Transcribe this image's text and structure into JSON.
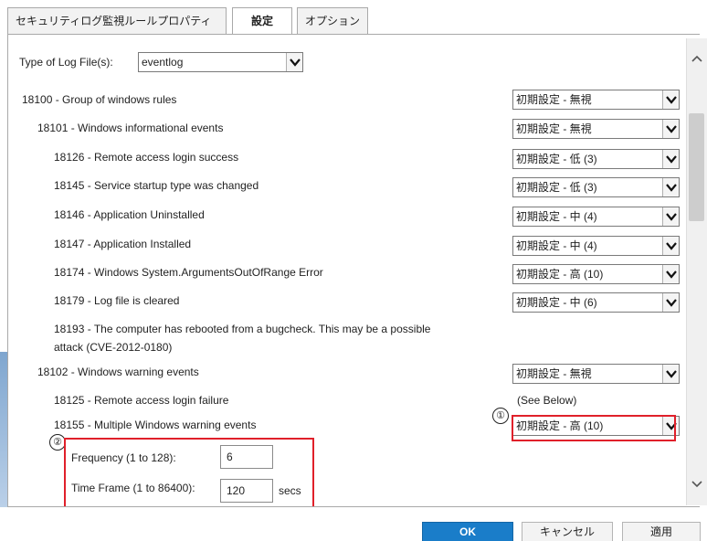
{
  "tabs": [
    {
      "label": "セキュリティログ監視ルールプロパティ"
    },
    {
      "label": "設定"
    },
    {
      "label": "オプション"
    }
  ],
  "log_type": {
    "label": "Type of Log File(s):",
    "value": "eventlog"
  },
  "rules": [
    {
      "text": "18100 - Group of windows rules",
      "level": "初期設定 - 無視"
    },
    {
      "text": "18101 - Windows informational events",
      "level": "初期設定 - 無視"
    },
    {
      "text": "18126 - Remote access login success",
      "level": "初期設定 - 低 (3)"
    },
    {
      "text": "18145 - Service startup type was changed",
      "level": "初期設定 - 低 (3)"
    },
    {
      "text": "18146 - Application Uninstalled",
      "level": "初期設定 - 中 (4)"
    },
    {
      "text": "18147 - Application Installed",
      "level": "初期設定 - 中 (4)"
    },
    {
      "text": "18174 - Windows System.ArgumentsOutOfRange Error",
      "level": "初期設定 - 高 (10)"
    },
    {
      "text": "18179 - Log file is cleared",
      "level": "初期設定 - 中 (6)"
    },
    {
      "text": "18193 - The computer has rebooted from a bugcheck. This may be a possible",
      "text2": "attack (CVE-2012-0180)"
    },
    {
      "text": "18102 - Windows warning events",
      "level": "初期設定 - 無視"
    },
    {
      "text": "18125 - Remote access login failure",
      "see_below": "(See Below)"
    },
    {
      "text": "18155 - Multiple Windows warning events",
      "level": "初期設定 - 高 (10)"
    }
  ],
  "frequency": {
    "label": "Frequency (1 to 128):",
    "value": "6"
  },
  "time_frame": {
    "label": "Time Frame (1 to 86400):",
    "value": "120",
    "unit": "secs"
  },
  "annotations": {
    "marker1": "①",
    "marker2": "②"
  },
  "buttons": {
    "ok": "OK",
    "cancel": "キャンセル",
    "apply": "適用"
  },
  "colors": {
    "primary_button": "#1a7dc9",
    "annotation_red": "#e0202a"
  }
}
